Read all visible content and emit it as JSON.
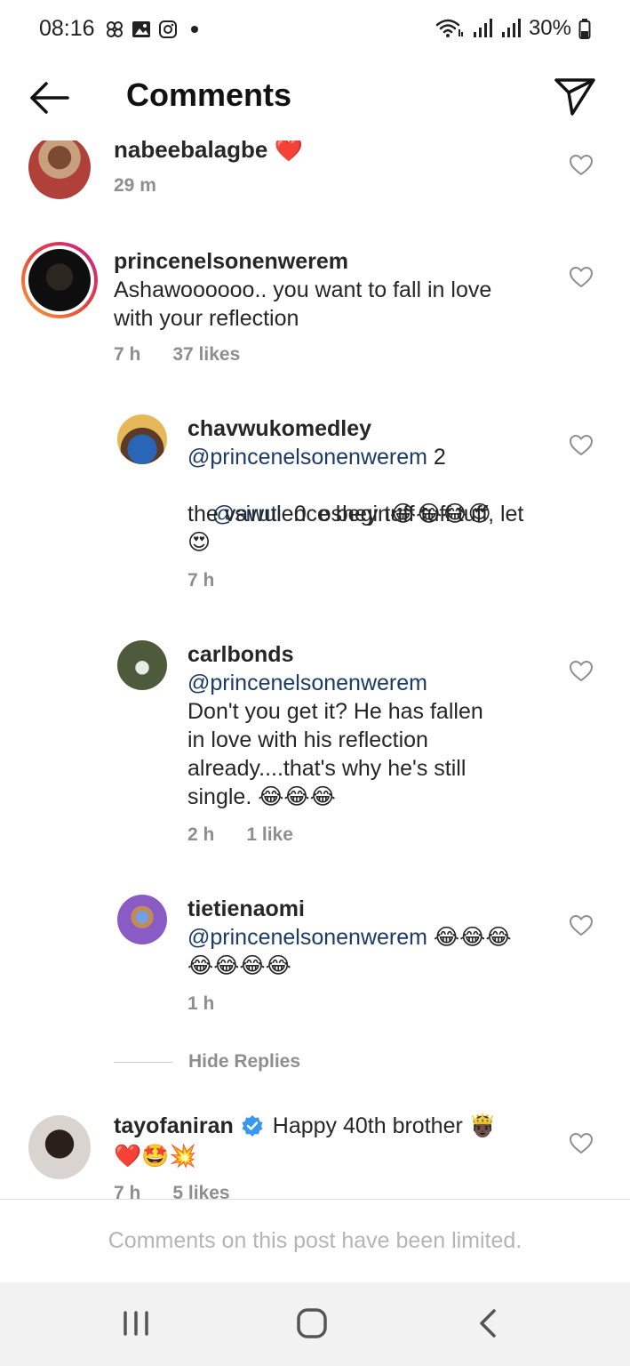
{
  "status_bar": {
    "time": "08:16",
    "left_icons": [
      "pinwheel-icon",
      "gallery-icon",
      "instagram-icon",
      "dot-icon"
    ],
    "battery": "30%"
  },
  "header": {
    "title": "Comments",
    "back_icon": "back-arrow-icon",
    "share_icon": "send-icon"
  },
  "comments": [
    {
      "username": "nabeebalagbe",
      "emoji": "❤️",
      "time": "29 m"
    },
    {
      "username": "princenelsonenwerem",
      "text": [
        "Ashawoooooo.. you want to fall in love",
        "with your reflection"
      ],
      "time": "7 h",
      "likes": "37 likes"
    },
    {
      "username": "chavwukomedley",
      "mention1": "@princenelsonenwerem",
      "mention1_suffix": " 2",
      "mention2": "@siruti",
      "mention2_suffix": "  0  oshey tuff tuff tuff, let",
      "line3": "the vawulence begin😂😂😂😍",
      "line4": "😍",
      "time": "7 h"
    },
    {
      "username": "carlbonds",
      "mention": "@princenelsonenwerem",
      "lines": [
        "Don't you get it? He has fallen",
        "in love with his reflection",
        "already....that's why he's still",
        "single. 😂😂😂"
      ],
      "time": "2 h",
      "likes": "1 like"
    },
    {
      "username": "tietienaomi",
      "mention": "@princenelsonenwerem",
      "mention_suffix": " 😂😂😂",
      "line2": "😂😂😂😂",
      "time": "1 h"
    },
    {
      "username": "tayofaniran",
      "text": "Happy 40th brother 🤴🏿",
      "line2": "❤️🤩💥",
      "time": "7 h",
      "likes": "5 likes"
    }
  ],
  "hide_replies": "Hide Replies",
  "limited_notice": "Comments on this post have been limited.",
  "colors": {
    "mention": "#1b3a66",
    "meta": "#8e8e8e",
    "verified": "#3897f0",
    "story_ring": [
      "#f9a33a",
      "#c91f8e"
    ]
  }
}
